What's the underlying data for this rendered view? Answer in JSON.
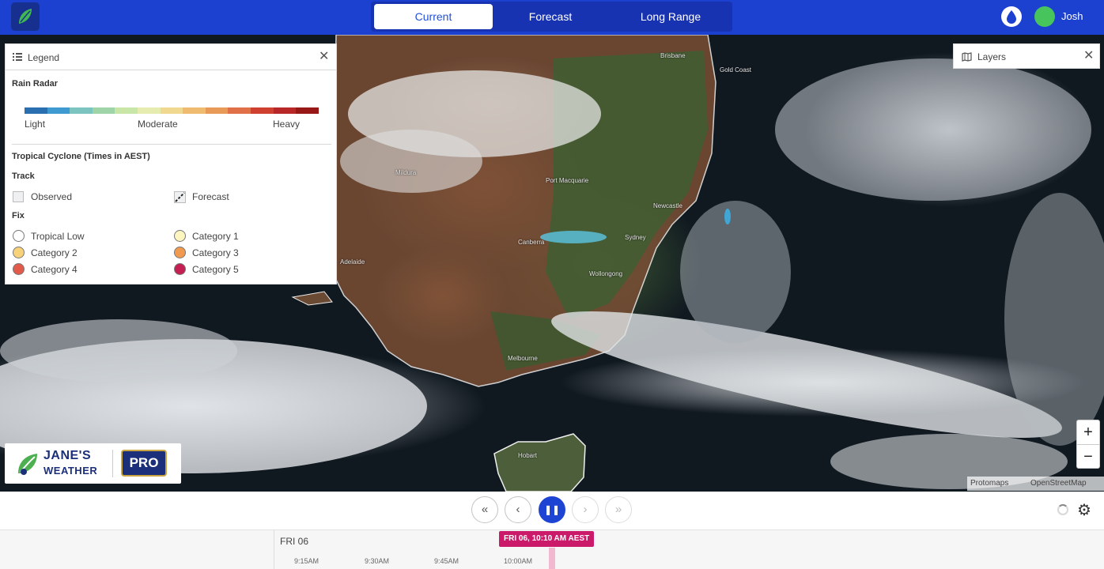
{
  "header": {
    "tabs": [
      {
        "label": "Current",
        "active": true
      },
      {
        "label": "Forecast",
        "active": false
      },
      {
        "label": "Long Range",
        "active": false
      }
    ],
    "user": {
      "name": "Josh"
    },
    "icons": {
      "logo": "leaf-logo-icon",
      "drop": "water-drop-icon"
    }
  },
  "legend": {
    "title": "Legend",
    "rain_radar": {
      "title": "Rain Radar",
      "scale": {
        "low": "Light",
        "mid": "Moderate",
        "high": "Heavy"
      },
      "colors": [
        "#2a6fb0",
        "#3e9ad0",
        "#7bc4c0",
        "#9fd3a8",
        "#c8e6a8",
        "#e6ecb0",
        "#f0d890",
        "#eebb70",
        "#e89a58",
        "#e07048",
        "#d04030",
        "#b82828",
        "#981818"
      ]
    },
    "cyclone": {
      "title": "Tropical Cyclone (Times in AEST)",
      "track_title": "Track",
      "observed": "Observed",
      "forecast": "Forecast",
      "fix_title": "Fix",
      "categories": [
        {
          "label": "Tropical Low",
          "color": "#ffffff"
        },
        {
          "label": "Category 1",
          "color": "#fdf5c0"
        },
        {
          "label": "Category 2",
          "color": "#f8d27a"
        },
        {
          "label": "Category 3",
          "color": "#ef9a4e"
        },
        {
          "label": "Category 4",
          "color": "#e25a4a"
        },
        {
          "label": "Category 5",
          "color": "#c41e52"
        }
      ]
    }
  },
  "layers": {
    "title": "Layers"
  },
  "brand": {
    "line1": "JANE'S",
    "line2": "WEATHER",
    "badge": "PRO"
  },
  "zoom": {
    "in": "+",
    "out": "−"
  },
  "attribution": {
    "a": "Protomaps",
    "b": "OpenStreetMap"
  },
  "map": {
    "places": [
      "Brisbane",
      "Gold Coast",
      "Port Macquarie",
      "Newcastle",
      "Sydney",
      "Wollongong",
      "Canberra",
      "Melbourne",
      "Hobart",
      "Mildura",
      "Adelaide"
    ]
  },
  "playback": {
    "buttons": {
      "first": "«",
      "prev": "‹",
      "play": "❚❚",
      "next": "›",
      "last": "»"
    }
  },
  "timeline": {
    "day": "FRI 06",
    "current": "FRI 06, 10:10 AM AEST",
    "ticks": [
      "9:15AM",
      "9:30AM",
      "9:45AM",
      "10:00AM"
    ]
  }
}
